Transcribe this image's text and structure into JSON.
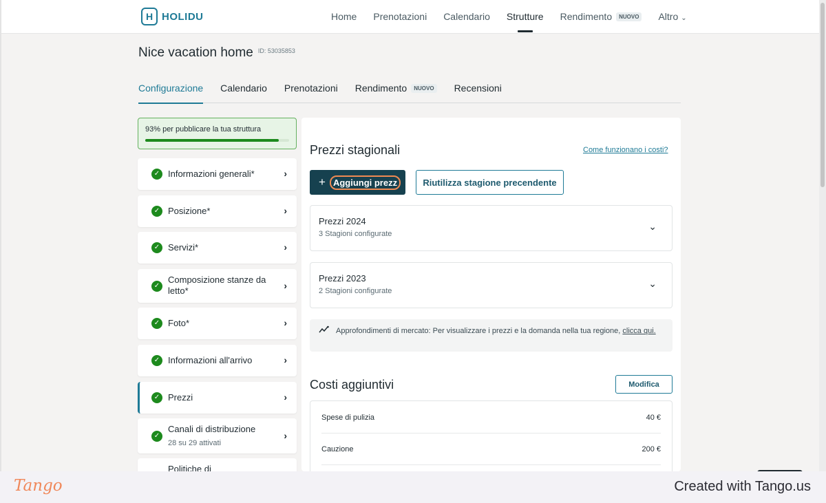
{
  "nav": {
    "brand": "HOLIDU",
    "items": [
      {
        "label": "Home"
      },
      {
        "label": "Prenotazioni"
      },
      {
        "label": "Calendario"
      },
      {
        "label": "Strutture",
        "active": true
      },
      {
        "label": "Rendimento",
        "badge": "NUOVO"
      },
      {
        "label": "Altro",
        "dropdown": true
      }
    ]
  },
  "property": {
    "title": "Nice vacation home",
    "id_label": "ID: 53035853"
  },
  "tabs": [
    {
      "label": "Configurazione",
      "active": true
    },
    {
      "label": "Calendario"
    },
    {
      "label": "Prenotazioni"
    },
    {
      "label": "Rendimento",
      "badge": "NUOVO"
    },
    {
      "label": "Recensioni"
    }
  ],
  "progress": {
    "text": "93% per pubblicare la tua struttura",
    "percent": 93,
    "color": "#1d8a1d"
  },
  "sidebar": {
    "items": [
      {
        "label": "Informazioni generali*"
      },
      {
        "label": "Posizione*"
      },
      {
        "label": "Servizi*"
      },
      {
        "label": "Composizione stanze da letto*"
      },
      {
        "label": "Foto*"
      },
      {
        "label": "Informazioni all'arrivo"
      },
      {
        "label": "Prezzi",
        "selected": true
      },
      {
        "label": "Canali di distribuzione",
        "sub": "28 su 29 attivati"
      },
      {
        "label": "Politiche di"
      }
    ]
  },
  "seasonal": {
    "title": "Prezzi stagionali",
    "help_link": "Come funzionano i costi?",
    "add_button": "Aggiungi prezz",
    "reuse_button": "Riutilizza stagione precendente",
    "seasons": [
      {
        "title": "Prezzi 2024",
        "sub": "3 Stagioni configurate"
      },
      {
        "title": "Prezzi 2023",
        "sub": "2 Stagioni configurate"
      }
    ],
    "insight_text": "Approfondimenti di mercato: Per visualizzare i prezzi e la domanda nella tua regione, ",
    "insight_link": "clicca qui."
  },
  "additional_costs": {
    "title": "Costi aggiuntivi",
    "edit_button": "Modifica",
    "rows": [
      {
        "label": "Spese di pulizia",
        "value": "40 €"
      },
      {
        "label": "Cauzione",
        "value": "200 €"
      }
    ]
  },
  "footer": {
    "logo": "Tango",
    "created": "Created with Tango.us"
  },
  "colors": {
    "accent": "#1e7a96",
    "primary_button": "#16414f",
    "success": "#1d8a1d",
    "highlight": "#f08a52"
  }
}
